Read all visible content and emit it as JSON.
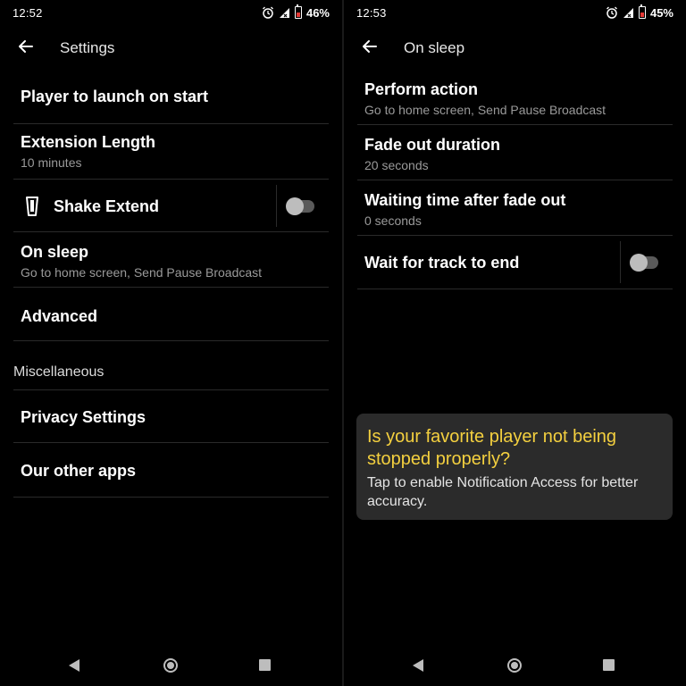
{
  "left": {
    "status": {
      "time": "12:52",
      "battery": "46%"
    },
    "title": "Settings",
    "items": [
      {
        "title": "Player to launch on start"
      },
      {
        "title": "Extension Length",
        "subtitle": "10 minutes"
      },
      {
        "title": "Shake Extend",
        "toggle": false
      },
      {
        "title": "On sleep",
        "subtitle": "Go to home screen, Send Pause Broadcast"
      },
      {
        "title": "Advanced"
      }
    ],
    "section": "Miscellaneous",
    "misc_items": [
      {
        "title": "Privacy Settings"
      },
      {
        "title": "Our other apps"
      }
    ]
  },
  "right": {
    "status": {
      "time": "12:53",
      "battery": "45%"
    },
    "title": "On sleep",
    "items": [
      {
        "title": "Perform action",
        "subtitle": "Go to home screen, Send Pause Broadcast"
      },
      {
        "title": "Fade out duration",
        "subtitle": "20 seconds"
      },
      {
        "title": "Waiting time after fade out",
        "subtitle": "0 seconds"
      },
      {
        "title": "Wait for track to end",
        "toggle": false
      }
    ],
    "card": {
      "title": "Is your favorite player not being stopped properly?",
      "body": "Tap to enable Notification Access for better accuracy."
    }
  },
  "colors": {
    "background": "#000000",
    "accent_text": "#f4d03f",
    "card": "#2b2b2b"
  },
  "icons": [
    "back-arrow-icon",
    "alarm-icon",
    "signal-icon",
    "battery-icon",
    "phone-shake-icon",
    "nav-back-icon",
    "nav-home-icon",
    "nav-recent-icon"
  ]
}
